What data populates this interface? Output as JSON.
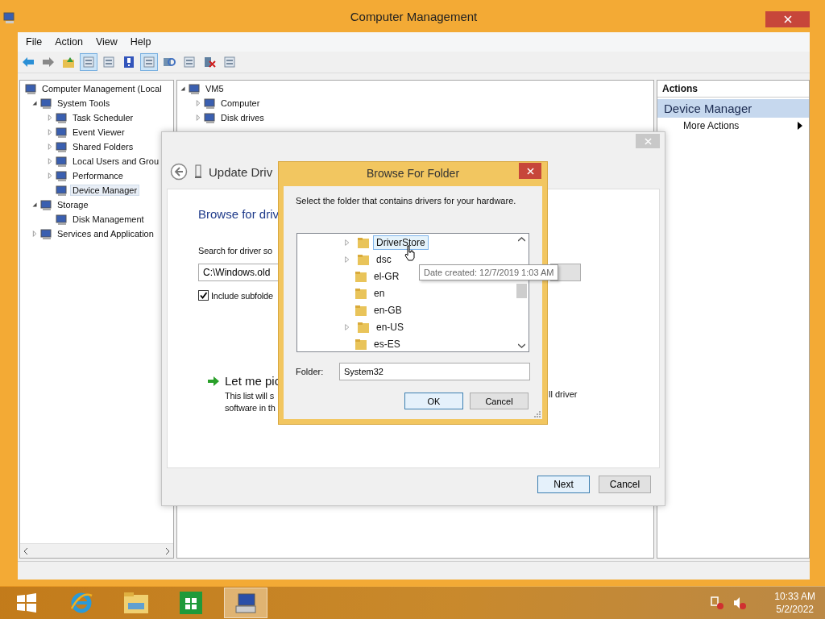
{
  "window": {
    "title": "Computer Management"
  },
  "menu": [
    "File",
    "Action",
    "View",
    "Help"
  ],
  "toolbar": [
    {
      "selected": false
    },
    {
      "selected": false
    },
    {
      "selected": false
    },
    {
      "selected": true
    },
    {
      "selected": false
    },
    {
      "selected": false
    },
    {
      "selected": true
    },
    {
      "selected": false
    },
    {
      "selected": false
    },
    {
      "selected": false
    },
    {
      "selected": false
    }
  ],
  "tree": [
    {
      "label": "Computer Management (Local",
      "selected": false,
      "children": [
        {
          "label": "System Tools",
          "expanded": true,
          "selected": false,
          "children": [
            {
              "label": "Task Scheduler",
              "expanded": false,
              "selected": false
            },
            {
              "label": "Event Viewer",
              "expanded": false,
              "selected": false
            },
            {
              "label": "Shared Folders",
              "expanded": false,
              "selected": false
            },
            {
              "label": "Local Users and Grou",
              "expanded": false,
              "selected": false
            },
            {
              "label": "Performance",
              "expanded": false,
              "selected": false
            },
            {
              "label": "Device Manager",
              "selected": true
            }
          ]
        },
        {
          "label": "Storage",
          "expanded": true,
          "selected": false,
          "children": [
            {
              "label": "Disk Management",
              "selected": false
            }
          ]
        },
        {
          "label": "Services and Application",
          "expanded": false,
          "selected": false
        }
      ]
    }
  ],
  "devices": [
    {
      "label": "VM5",
      "expanded": true,
      "selected": false,
      "children": [
        {
          "label": "Computer",
          "expanded": false,
          "selected": false
        },
        {
          "label": "Disk drives",
          "expanded": false,
          "selected": false
        }
      ]
    }
  ],
  "actions": {
    "header": "Actions",
    "section": "Device Manager",
    "items": [
      "More Actions"
    ]
  },
  "wizard": {
    "title": "Update Driv",
    "heading": "Browse for driv",
    "search_label": "Search for driver so",
    "path": "C:\\Windows.old",
    "include_subfolders": {
      "label": "Include subfolde",
      "checked": true
    },
    "pick": {
      "title": "Let me pic",
      "lines": [
        "This list will s",
        "software in th"
      ],
      "tail": "ll driver"
    },
    "buttons": [
      {
        "label": "Next",
        "default": true
      },
      {
        "label": "Cancel",
        "default": false
      }
    ]
  },
  "browse": {
    "title": "Browse For Folder",
    "prompt": "Select the folder that contains drivers for your hardware.",
    "folders": [
      {
        "label": "DriverStore",
        "expandable": true,
        "hovered": true
      },
      {
        "label": "dsc",
        "expandable": true,
        "hovered": false
      },
      {
        "label": "el-GR",
        "expandable": false,
        "hovered": false
      },
      {
        "label": "en",
        "expandable": false,
        "hovered": false
      },
      {
        "label": "en-GB",
        "expandable": false,
        "hovered": false
      },
      {
        "label": "en-US",
        "expandable": true,
        "hovered": false
      },
      {
        "label": "es-ES",
        "expandable": false,
        "hovered": false
      }
    ],
    "folder_label": "Folder:",
    "folder_value": "System32",
    "buttons": [
      {
        "label": "OK",
        "default": true
      },
      {
        "label": "Cancel",
        "default": false
      }
    ],
    "tooltip": "Date created: 12/7/2019 1:03 AM"
  },
  "taskbar": {
    "apps": [
      {
        "selected": false
      },
      {
        "selected": false
      },
      {
        "selected": false
      },
      {
        "selected": false
      },
      {
        "selected": true
      }
    ],
    "clock": {
      "time": "10:33 AM",
      "date": "5/2/2022"
    }
  }
}
